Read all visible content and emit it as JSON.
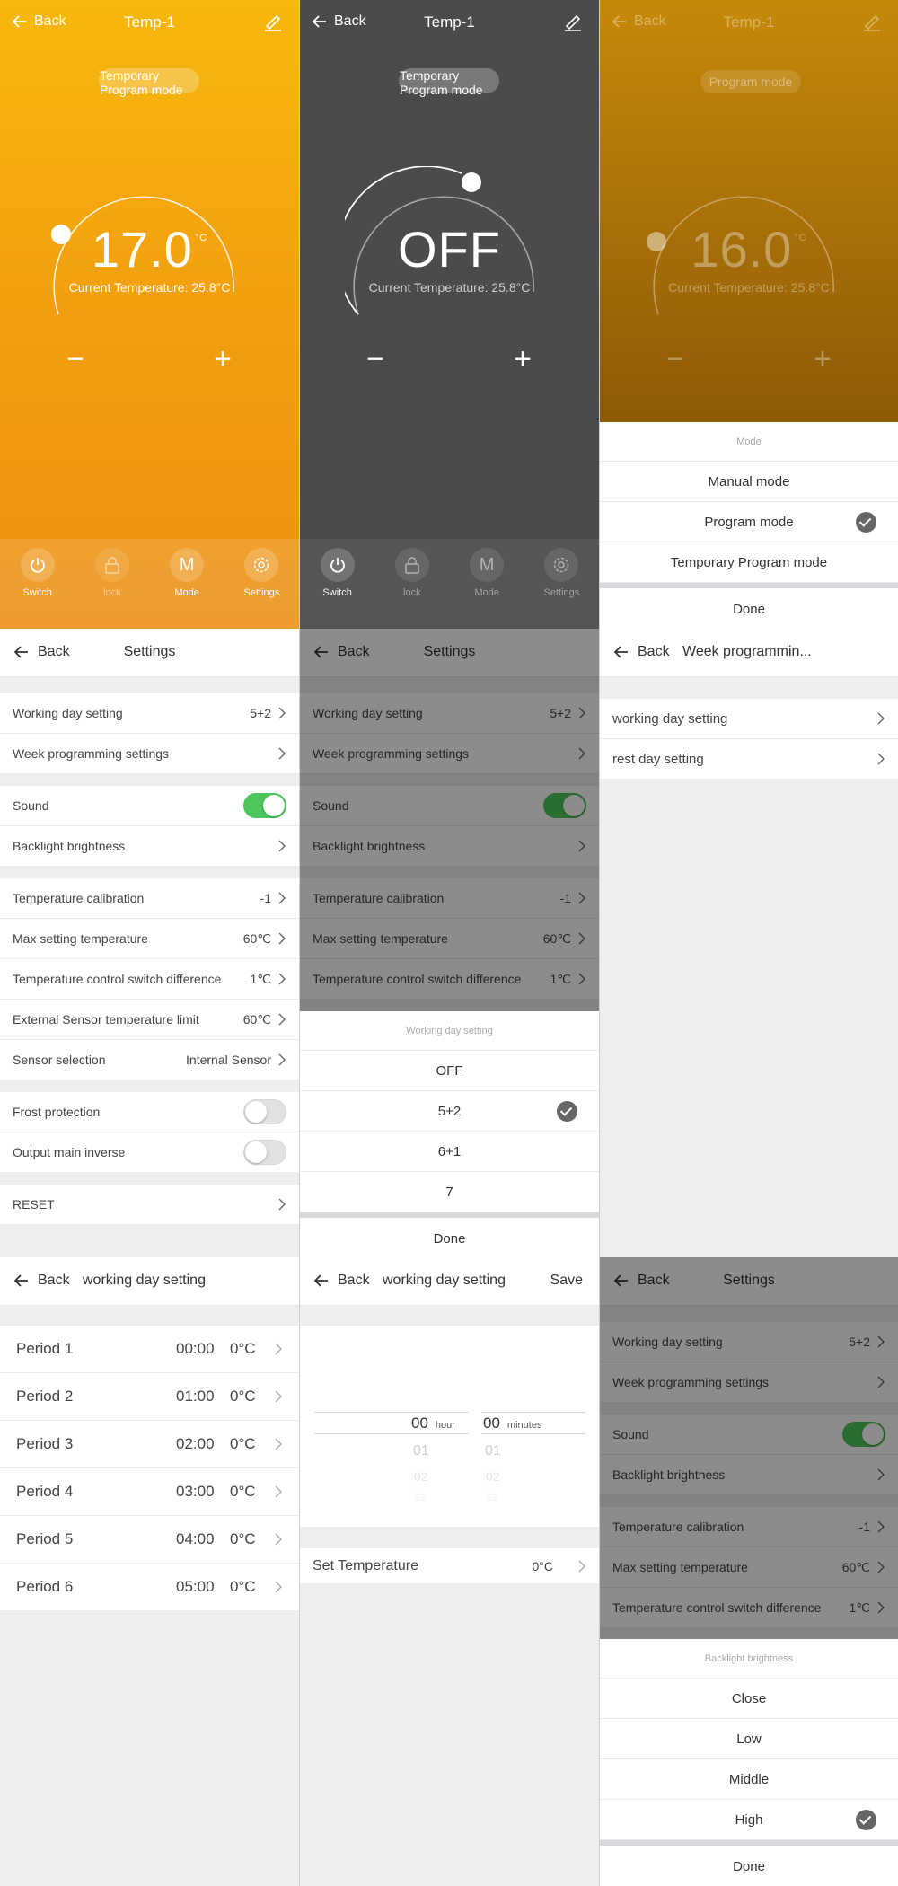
{
  "thermostat": {
    "back_label": "Back",
    "title": "Temp-1",
    "screens": [
      {
        "mode_label": "Temporary\nProgram mode",
        "temperature": "17.0",
        "unit": "°C",
        "current": "Current Temperature: 25.8°C"
      },
      {
        "mode_label": "Temporary\nProgram mode",
        "temperature": "OFF",
        "unit": "",
        "current": "Current Temperature: 25.8°C"
      },
      {
        "mode_label": "Program mode",
        "temperature": "16.0",
        "unit": "°C",
        "current": "Current Temperature: 25.8°C"
      }
    ],
    "minus_symbol": "−",
    "plus_symbol": "+",
    "nav": {
      "switch": "Switch",
      "lock": "lock",
      "mode": "Mode",
      "mode_glyph": "M",
      "settings": "Settings"
    }
  },
  "mode_sheet": {
    "header": "Mode",
    "options": [
      "Manual mode",
      "Program mode",
      "Temporary Program mode"
    ],
    "selected_index": 1,
    "done": "Done"
  },
  "settings": {
    "back_label": "Back",
    "title": "Settings",
    "rows": {
      "working_day": {
        "label": "Working day setting",
        "value": "5+2"
      },
      "week_prog": {
        "label": "Week programming settings"
      },
      "sound": {
        "label": "Sound",
        "on": true
      },
      "backlight": {
        "label": "Backlight brightness"
      },
      "temp_cal": {
        "label": "Temperature calibration",
        "value": "-1"
      },
      "max_temp": {
        "label": "Max setting temperature",
        "value": "60℃"
      },
      "switch_diff": {
        "label": "Temperature control switch difference",
        "value": "1℃"
      },
      "ext_limit": {
        "label": "External Sensor temperature limit",
        "value": "60℃"
      },
      "sensor": {
        "label": "Sensor selection",
        "value": "Internal Sensor"
      },
      "frost": {
        "label": "Frost protection",
        "on": false
      },
      "output": {
        "label": "Output main inverse",
        "on": false
      },
      "reset": {
        "label": "RESET"
      }
    }
  },
  "working_day_sheet": {
    "header": "Working day setting",
    "options": [
      "OFF",
      "5+2",
      "6+1",
      "7"
    ],
    "selected_index": 1,
    "done": "Done"
  },
  "week_programming": {
    "back_label": "Back",
    "title": "Week programmin...",
    "items": [
      "working day setting",
      "rest day setting"
    ]
  },
  "working_day_setting": {
    "back_label": "Back",
    "title": "working day setting",
    "periods": [
      {
        "name": "Period 1",
        "time": "00:00",
        "temp": "0°C"
      },
      {
        "name": "Period 2",
        "time": "01:00",
        "temp": "0°C"
      },
      {
        "name": "Period 3",
        "time": "02:00",
        "temp": "0°C"
      },
      {
        "name": "Period 4",
        "time": "03:00",
        "temp": "0°C"
      },
      {
        "name": "Period 5",
        "time": "04:00",
        "temp": "0°C"
      },
      {
        "name": "Period 6",
        "time": "05:00",
        "temp": "0°C"
      }
    ]
  },
  "period_edit": {
    "back_label": "Back",
    "title": "working day setting",
    "save": "Save",
    "hour": {
      "value": "00",
      "unit": "hour",
      "next": "01",
      "next2": "02",
      "next3": "03"
    },
    "minutes": {
      "value": "00",
      "unit": "minutes",
      "next": "01",
      "next2": "02",
      "next3": "03"
    },
    "set_temperature": {
      "label": "Set Temperature",
      "value": "0°C"
    }
  },
  "backlight_sheet": {
    "header": "Backlight brightness",
    "options": [
      "Close",
      "Low",
      "Middle",
      "High"
    ],
    "selected_index": 3,
    "done": "Done"
  }
}
